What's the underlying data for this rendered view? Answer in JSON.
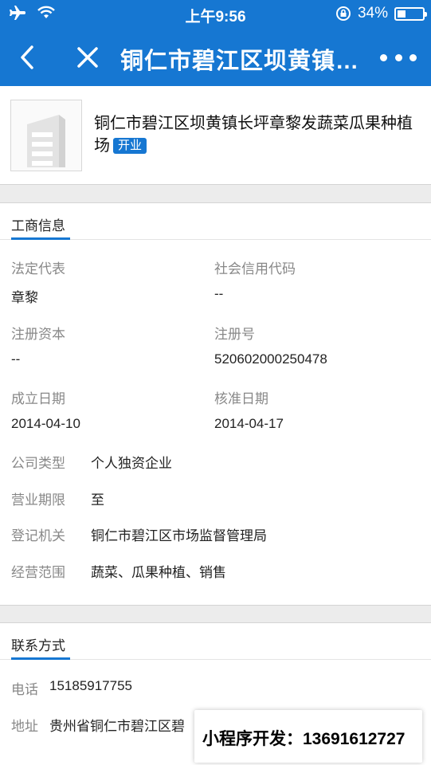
{
  "status_bar": {
    "time": "上午9:56",
    "battery": "34%",
    "battery_level": 0.34
  },
  "nav": {
    "title": "铜仁市碧江区坝黄镇长坪章黎发蔬菜瓜果种植场"
  },
  "company": {
    "name": "铜仁市碧江区坝黄镇长坪章黎发蔬菜瓜果种植场",
    "status_badge": "开业"
  },
  "business_info": {
    "title": "工商信息",
    "legal_rep": {
      "label": "法定代表",
      "value": "章黎"
    },
    "credit_code": {
      "label": "社会信用代码",
      "value": "--"
    },
    "reg_capital": {
      "label": "注册资本",
      "value": "--"
    },
    "reg_number": {
      "label": "注册号",
      "value": "520602000250478"
    },
    "established": {
      "label": "成立日期",
      "value": "2014-04-10"
    },
    "approved": {
      "label": "核准日期",
      "value": "2014-04-17"
    },
    "company_type": {
      "label": "公司类型",
      "value": "个人独资企业"
    },
    "term": {
      "label": "营业期限",
      "value": "至"
    },
    "authority": {
      "label": "登记机关",
      "value": "铜仁市碧江区市场监督管理局"
    },
    "scope": {
      "label": "经营范围",
      "value": "蔬菜、瓜果种植、销售"
    }
  },
  "contact": {
    "title": "联系方式",
    "phone": {
      "label": "电话",
      "value": "15185917755"
    },
    "address": {
      "label": "地址",
      "value": "贵州省铜仁市碧江区碧"
    }
  },
  "watermark": "小程序开发：13691612727"
}
